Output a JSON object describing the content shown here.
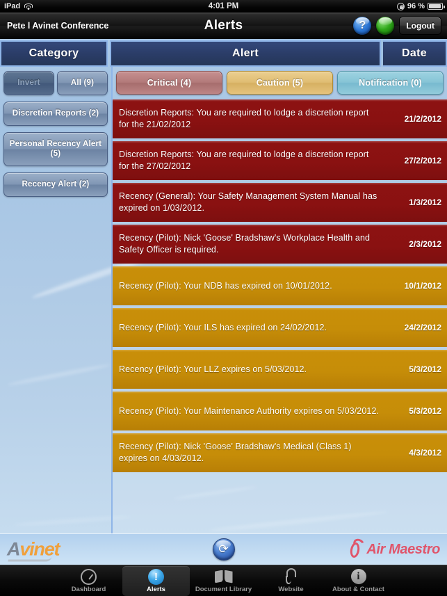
{
  "status_bar": {
    "device": "iPad",
    "wifi_icon": "wifi-icon",
    "time": "4:01 PM",
    "rotation_lock_icon": "rotation-lock-icon",
    "battery_percent": "96 %",
    "battery_icon": "battery-charging-icon"
  },
  "nav_bar": {
    "user": "Pete l Avinet Conference",
    "title": "Alerts",
    "help_icon": "help-question-icon",
    "status_orb_icon": "green-status-orb-icon",
    "logout_label": "Logout"
  },
  "columns": {
    "category": "Category",
    "alert": "Alert",
    "date": "Date"
  },
  "category_panel": {
    "invert_label": "Invert",
    "all_label": "All (9)",
    "items": [
      {
        "label": "Discretion Reports (2)"
      },
      {
        "label": "Personal Recency Alert (5)"
      },
      {
        "label": "Recency Alert (2)"
      }
    ]
  },
  "severity_filters": [
    {
      "label": "Critical (4)",
      "key": "critical",
      "color": "#b37a7a"
    },
    {
      "label": "Caution (5)",
      "key": "caution",
      "color": "#e0bd72"
    },
    {
      "label": "Notification (0)",
      "key": "notification",
      "color": "#86c4d6"
    }
  ],
  "alerts": [
    {
      "severity": "critical",
      "message": "Discretion Reports: You are required to lodge a discretion report for the 21/02/2012",
      "date": "21/2/2012"
    },
    {
      "severity": "critical",
      "message": "Discretion Reports: You are required to lodge a discretion report for the 27/02/2012",
      "date": "27/2/2012"
    },
    {
      "severity": "critical",
      "message": "Recency (General): Your Safety Management System Manual has expired on 1/03/2012.",
      "date": "1/3/2012"
    },
    {
      "severity": "critical",
      "message": "Recency (Pilot): Nick 'Goose' Bradshaw's Workplace Health and Safety Officer is required.",
      "date": "2/3/2012"
    },
    {
      "severity": "caution",
      "message": "Recency (Pilot): Your NDB has expired on 10/01/2012.",
      "date": "10/1/2012"
    },
    {
      "severity": "caution",
      "message": "Recency (Pilot): Your ILS has expired on 24/02/2012.",
      "date": "24/2/2012"
    },
    {
      "severity": "caution",
      "message": "Recency (Pilot): Your LLZ expires on 5/03/2012.",
      "date": "5/3/2012"
    },
    {
      "severity": "caution",
      "message": "Recency (Pilot): Your Maintenance Authority expires on 5/03/2012.",
      "date": "5/3/2012"
    },
    {
      "severity": "caution",
      "message": "Recency (Pilot): Nick 'Goose' Bradshaw's Medical (Class 1) expires on 4/03/2012.",
      "date": "4/3/2012"
    }
  ],
  "footer": {
    "avinet_logo_part1": "A",
    "avinet_logo_part2": "vinet",
    "refresh_icon": "refresh-sync-icon",
    "air_maestro_logo": "Air Maestro",
    "air_maestro_mark_icon": "air-maestro-mark-icon"
  },
  "tabs": [
    {
      "label": "Dashboard",
      "icon": "gauge-icon",
      "active": false
    },
    {
      "label": "Alerts",
      "icon": "alert-exclamation-icon",
      "active": true
    },
    {
      "label": "Document Library",
      "icon": "book-icon",
      "active": false
    },
    {
      "label": "Website",
      "icon": "hook-link-icon",
      "active": false
    },
    {
      "label": "About & Contact",
      "icon": "info-icon",
      "active": false
    }
  ]
}
